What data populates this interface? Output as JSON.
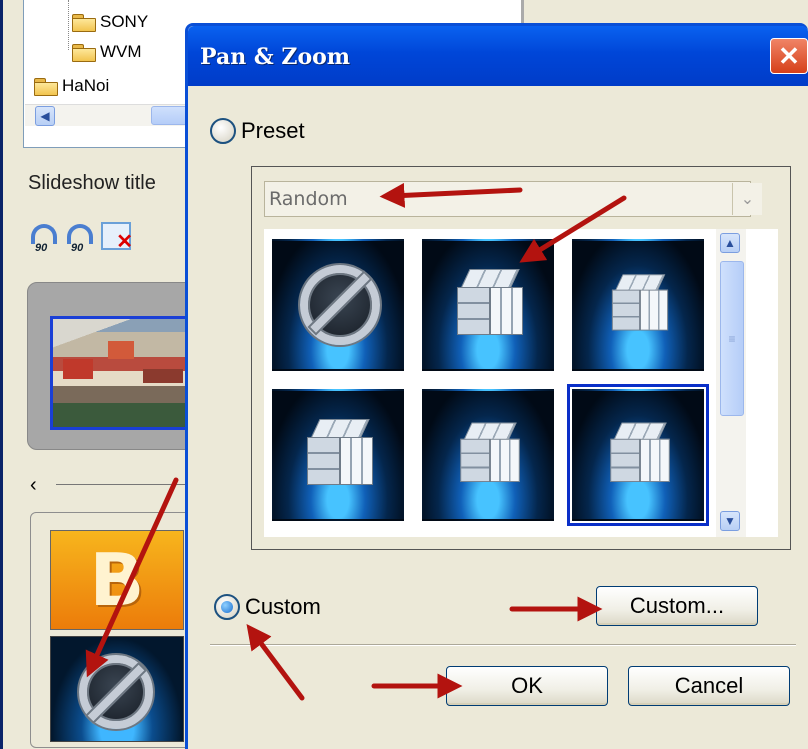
{
  "background": {
    "tree_items": [
      {
        "label": "SONY",
        "icon": "folder-icon"
      },
      {
        "label": "WVM",
        "icon": "folder-icon"
      },
      {
        "label": "HaNoi",
        "icon": "folder-icon"
      }
    ],
    "slideshow_label": "Slideshow title",
    "rotate_left_num": "90",
    "rotate_right_num": "90",
    "thumb_letter": "B"
  },
  "dialog": {
    "title": "Pan & Zoom",
    "close_glyph": "✕",
    "preset_label": "Preset",
    "custom_label": "Custom",
    "dropdown_value": "Random",
    "dropdown_arrow": "⌄",
    "custom_button": "Custom...",
    "ok_button": "OK",
    "cancel_button": "Cancel",
    "selected_radio": "custom",
    "effects": [
      "no-effect-icon",
      "cube-icon",
      "cube-icon",
      "cube-icon",
      "cube-icon",
      "cube-icon"
    ],
    "selected_effect_index": 5
  },
  "colors": {
    "titlebar": "#0046d8",
    "arrow": "#b3130f",
    "selection": "#0a2fc8"
  }
}
